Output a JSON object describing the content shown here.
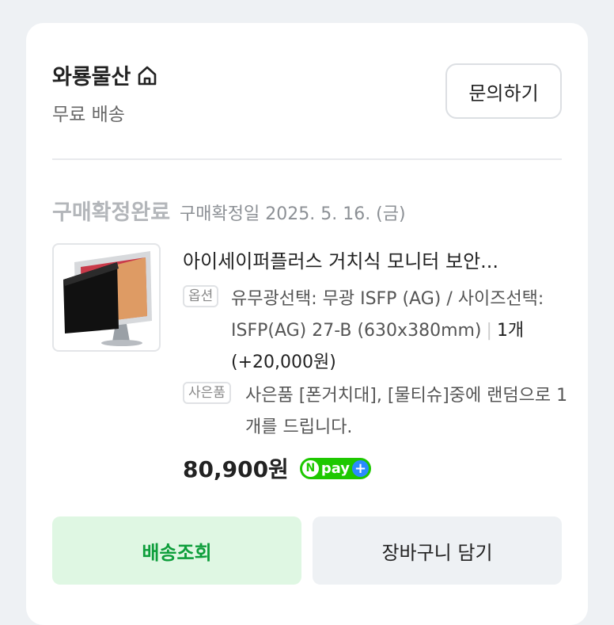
{
  "seller": {
    "name": "와룡물산",
    "shipping": "무료 배송",
    "inquiry_label": "문의하기"
  },
  "order": {
    "status": "구매확정완료",
    "confirm_date": "구매확정일 2025. 5. 16. (금)"
  },
  "product": {
    "title": "아이세이퍼플러스 거치식 모니터 보안...",
    "option_tag": "옵션",
    "option_text": "유무광선택: 무광 ISFP (AG) / 사이즈선택: ISFP(AG) 27-B (630x380mm)",
    "quantity": "1개 (+20,000원)",
    "gift_tag": "사은품",
    "gift_text": "사은품 [폰거치대], [물티슈]중에 랜덤으로 1개를 드립니다.",
    "price": "80,900원",
    "npay_brand": "pay"
  },
  "actions": {
    "track_label": "배송조회",
    "cart_label": "장바구니 담기"
  },
  "colors": {
    "accent_green": "#0d9e3b",
    "track_bg": "#dff7e3",
    "npay_green": "#1ec800",
    "npay_plus_blue": "#2a8bff"
  },
  "icons": {
    "seller_home": "home-icon",
    "product_image": "monitor-privacy-filter"
  }
}
